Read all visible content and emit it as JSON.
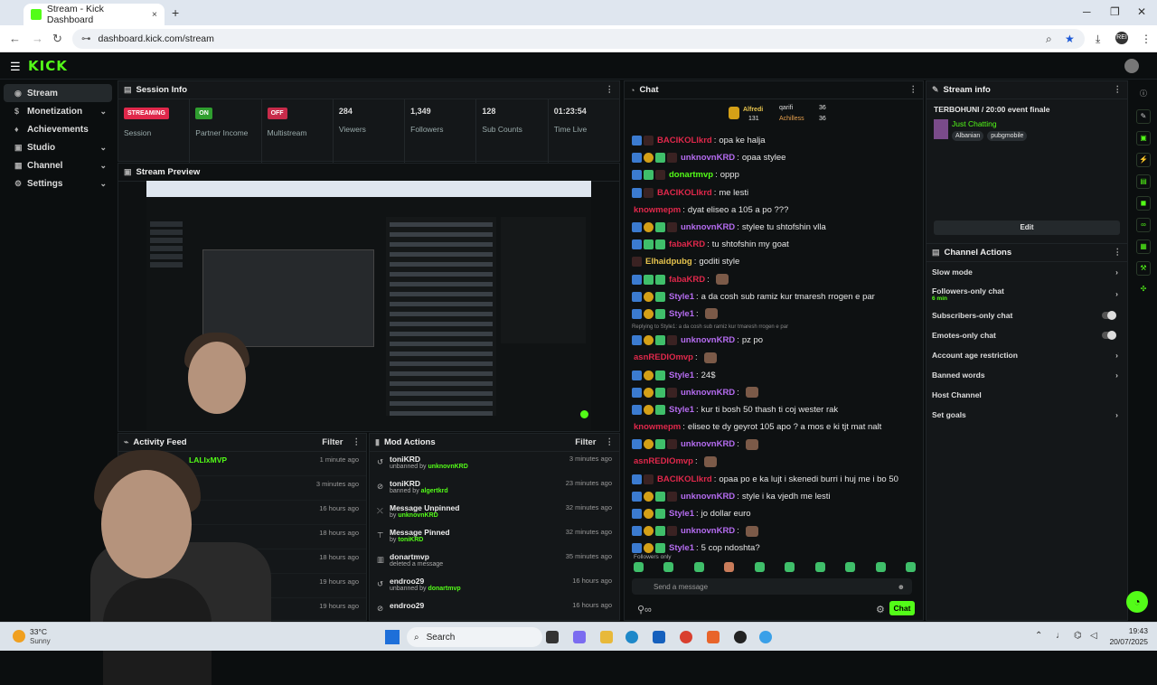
{
  "browser": {
    "tab_title": "Stream - Kick Dashboard",
    "url": "dashboard.kick.com/stream",
    "new_tab": "+",
    "close": "×",
    "profile": "REI"
  },
  "app": {
    "logo": "KICK"
  },
  "sidebar": {
    "items": [
      {
        "label": "Stream",
        "icon": "stream-icon"
      },
      {
        "label": "Monetization",
        "icon": "dollar-icon"
      },
      {
        "label": "Achievements",
        "icon": "trophy-icon"
      },
      {
        "label": "Studio",
        "icon": "studio-icon"
      },
      {
        "label": "Channel",
        "icon": "channel-icon"
      },
      {
        "label": "Settings",
        "icon": "gear-icon"
      }
    ]
  },
  "session": {
    "title": "Session Info",
    "stats": [
      {
        "value": "STREAMING",
        "label": "Session",
        "color": "#e0284b"
      },
      {
        "value": "ON",
        "label": "Partner Income",
        "color": "#2f9e2f"
      },
      {
        "value": "OFF",
        "label": "Multistream",
        "color": "#c72b4a"
      },
      {
        "value": "284",
        "label": "Viewers"
      },
      {
        "value": "1,349",
        "label": "Followers"
      },
      {
        "value": "128",
        "label": "Sub Counts"
      },
      {
        "value": "01:23:54",
        "label": "Time Live"
      }
    ]
  },
  "preview": {
    "title": "Stream Preview"
  },
  "activity": {
    "title": "Activity Feed",
    "filter": "Filter",
    "rows": [
      {
        "name": "LALIxMVP",
        "time": "1 minute ago"
      },
      {
        "name": "",
        "time": "3 minutes ago"
      },
      {
        "name": "",
        "time": "16 hours ago"
      },
      {
        "name": "",
        "time": "18 hours ago"
      },
      {
        "name": "",
        "time": "18 hours ago"
      },
      {
        "name": "",
        "time": "19 hours ago"
      },
      {
        "name": "",
        "time": "19 hours ago"
      }
    ]
  },
  "mod": {
    "title": "Mod Actions",
    "filter": "Filter",
    "rows": [
      {
        "who": "toniKRD",
        "action": "unbanned by",
        "by": "unknovnKRD",
        "time": "3 minutes ago"
      },
      {
        "who": "toniKRD",
        "action": "banned by",
        "by": "algertkrd",
        "time": "23 minutes ago"
      },
      {
        "who": "Message Unpinned",
        "action": "by",
        "by": "unknovnKRD",
        "time": "32 minutes ago"
      },
      {
        "who": "Message Pinned",
        "action": "by",
        "by": "toniKRD",
        "time": "32 minutes ago"
      },
      {
        "who": "donartmvp",
        "action": "deleted a message",
        "by": "",
        "time": "35 minutes ago"
      },
      {
        "who": "endroo29",
        "action": "unbanned by",
        "by": "donartmvp",
        "time": "16 hours ago"
      },
      {
        "who": "endroo29",
        "action": "",
        "by": "",
        "time": "16 hours ago"
      }
    ]
  },
  "chat": {
    "title": "Chat",
    "pinned": [
      {
        "name": "Alfredi",
        "val": "131"
      },
      {
        "name": "qarifi",
        "val": "36"
      },
      {
        "name": "Achilless",
        "val": "36"
      }
    ],
    "lines": [
      {
        "badges": [
          "b1",
          "b4"
        ],
        "name": "BACIKOLlkrd",
        "color": "#e0284b",
        "text": "opa ke halja"
      },
      {
        "badges": [
          "b1",
          "b2",
          "b3",
          "b4"
        ],
        "name": "unknovnKRD",
        "color": "#b56cf0",
        "text": "opaa stylee"
      },
      {
        "badges": [
          "b1",
          "b3",
          "b4"
        ],
        "name": "donartmvp",
        "color": "#53fc18",
        "text": "oppp"
      },
      {
        "badges": [
          "b1",
          "b4"
        ],
        "name": "BACIKOLlkrd",
        "color": "#e0284b",
        "text": "me lesti"
      },
      {
        "badges": [],
        "name": "knowmepm",
        "color": "#e0284b",
        "text": "dyat eliseo a 105 a po ???"
      },
      {
        "badges": [
          "b1",
          "b2",
          "b3",
          "b4"
        ],
        "name": "unknovnKRD",
        "color": "#b56cf0",
        "text": "stylee tu shtofshin vlla"
      },
      {
        "badges": [
          "b1",
          "b3",
          "b3"
        ],
        "name": "fabaKRD",
        "color": "#e0284b",
        "text": "tu shtofshin my goat"
      },
      {
        "badges": [
          "b4"
        ],
        "name": "Elhaidpubg",
        "color": "#e6c34d",
        "text": "goditi style"
      },
      {
        "badges": [
          "b1",
          "b3",
          "b3"
        ],
        "name": "fabaKRD",
        "color": "#e0284b",
        "text": ""
      },
      {
        "badges": [
          "b1",
          "b2",
          "b3"
        ],
        "name": "Style1",
        "color": "#b56cf0",
        "text": "a da cosh sub ramiz kur tmaresh rrogen e par"
      },
      {
        "badges": [
          "b1",
          "b2",
          "b3"
        ],
        "name": "Style1",
        "color": "#b56cf0",
        "text": ""
      },
      {
        "badges": [
          "b1",
          "b2",
          "b3",
          "b4"
        ],
        "name": "unknovnKRD",
        "color": "#b56cf0",
        "text": "pz po",
        "reply": "Replying to Style1: a da cosh sub ramiz kur tmaresh rrogen e par"
      },
      {
        "badges": [],
        "name": "asnREDIOmvp",
        "color": "#e0284b",
        "text": ""
      },
      {
        "badges": [
          "b1",
          "b2",
          "b3"
        ],
        "name": "Style1",
        "color": "#b56cf0",
        "text": "24$"
      },
      {
        "badges": [
          "b1",
          "b2",
          "b3",
          "b4"
        ],
        "name": "unknovnKRD",
        "color": "#b56cf0",
        "text": ""
      },
      {
        "badges": [
          "b1",
          "b2",
          "b3"
        ],
        "name": "Style1",
        "color": "#b56cf0",
        "text": "kur ti bosh 50 thash ti coj wester rak"
      },
      {
        "badges": [],
        "name": "knowmepm",
        "color": "#e0284b",
        "text": "eliseo te dy geyrot 105 apo ? a mos e ki tjt mat nalt"
      },
      {
        "badges": [
          "b1",
          "b2",
          "b3",
          "b4"
        ],
        "name": "unknovnKRD",
        "color": "#b56cf0",
        "text": ""
      },
      {
        "badges": [],
        "name": "asnREDIOmvp",
        "color": "#e0284b",
        "text": ""
      },
      {
        "badges": [
          "b1",
          "b4"
        ],
        "name": "BACIKOLlkrd",
        "color": "#e0284b",
        "text": "opaa po e ka lujt i skenedi burri i huj me i bo 50"
      },
      {
        "badges": [
          "b1",
          "b2",
          "b3",
          "b4"
        ],
        "name": "unknovnKRD",
        "color": "#b56cf0",
        "text": "style i ka vjedh me lesti"
      },
      {
        "badges": [
          "b1",
          "b2",
          "b3"
        ],
        "name": "Style1",
        "color": "#b56cf0",
        "text": "jo dollar euro"
      },
      {
        "badges": [
          "b1",
          "b2",
          "b3",
          "b4"
        ],
        "name": "unknovnKRD",
        "color": "#b56cf0",
        "text": ""
      },
      {
        "badges": [
          "b1",
          "b2",
          "b3"
        ],
        "name": "Style1",
        "color": "#b56cf0",
        "text": "5 cop ndoshta?"
      }
    ],
    "followers_only": "Followers only",
    "input_placeholder": "Send a message",
    "send": "Chat"
  },
  "stream_info": {
    "title": "Stream info",
    "stream_title": "TERBOHUNI / 20:00 event finale",
    "category": "Just Chatting",
    "tags": [
      "Albanian",
      "pubgmobile"
    ],
    "edit": "Edit"
  },
  "channel_actions": {
    "title": "Channel Actions",
    "rows": [
      {
        "label": "Slow mode",
        "type": "chevron"
      },
      {
        "label": "Followers-only chat",
        "sub": "6 min",
        "type": "chevron"
      },
      {
        "label": "Subscribers-only chat",
        "type": "toggle"
      },
      {
        "label": "Emotes-only chat",
        "type": "toggle"
      },
      {
        "label": "Account age restriction",
        "type": "chevron"
      },
      {
        "label": "Banned words",
        "type": "chevron"
      },
      {
        "label": "Host Channel",
        "type": "none"
      },
      {
        "label": "Set goals",
        "type": "chevron"
      }
    ]
  },
  "taskbar": {
    "search": "Search",
    "weather_temp": "33°C",
    "weather_desc": "Sunny",
    "time": "19:43",
    "date": "20/07/2025"
  }
}
